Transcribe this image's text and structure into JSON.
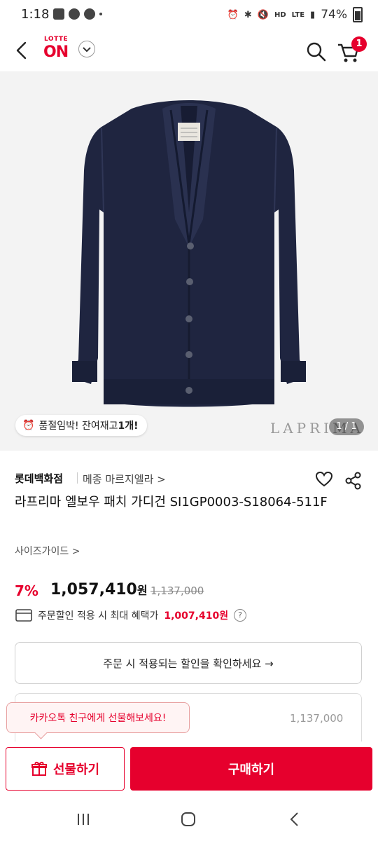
{
  "status_bar": {
    "time": "1:18",
    "network": "HD",
    "lte": "LTE",
    "battery": "74%"
  },
  "header": {
    "logo_small": "LOTTE",
    "logo_big": "ON",
    "cart_count": "1"
  },
  "hero": {
    "watermark": "LAPRIMA",
    "stock_alert_prefix": "품절임박! 잔여재고 ",
    "stock_alert_count": "1개!",
    "image_counter": "1 / 1"
  },
  "product": {
    "seller": "롯데백화점",
    "brand": "메종 마르지엘라 >",
    "title": "라프리마 엘보우 패치 가디건 SI1GP0003-S18064-511F",
    "size_guide": "사이즈가이드 >",
    "discount": "7%",
    "price": "1,057,410",
    "price_unit": "원",
    "original_price": "1,137,000",
    "benefit_prefix": "주문할인 적용 시 최대 혜택가",
    "benefit_price": "1,007,410원"
  },
  "confirm_button": "주문 시 적용되는 할인을 확인하세요 →",
  "coupon_amount": "1,137,000",
  "gift_tooltip": "카카오톡 친구에게 선물해보세요!",
  "bottom": {
    "gift_label": "선물하기",
    "buy_label": "구매하기"
  },
  "colors": {
    "accent": "#e6002d",
    "cardigan": "#1f2540"
  }
}
